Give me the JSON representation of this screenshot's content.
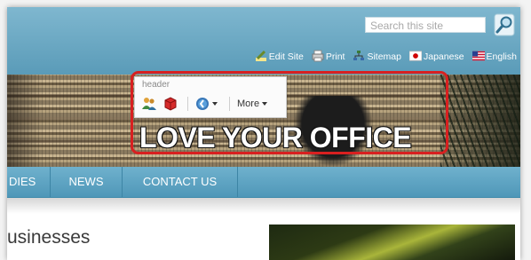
{
  "header": {
    "search": {
      "placeholder": "Search this site"
    },
    "links": [
      {
        "label": "Edit Site",
        "icon": "pencil-icon"
      },
      {
        "label": "Print",
        "icon": "printer-icon"
      },
      {
        "label": "Sitemap",
        "icon": "sitemap-icon"
      },
      {
        "label": "Japanese",
        "icon": "japan-flag-icon"
      },
      {
        "label": "English",
        "icon": "us-flag-icon"
      }
    ]
  },
  "banner": {
    "headline": "LOVE YOUR OFFICE",
    "popup": {
      "label": "header",
      "more_label": "More"
    }
  },
  "nav": {
    "items": [
      {
        "label": "DIES"
      },
      {
        "label": "NEWS"
      },
      {
        "label": "CONTACT US"
      }
    ]
  },
  "content": {
    "section_title": "usinesses"
  },
  "colors": {
    "header_blue": "#6aa9c4",
    "nav_blue": "#5aa1c1",
    "highlight_red": "#d82020"
  }
}
